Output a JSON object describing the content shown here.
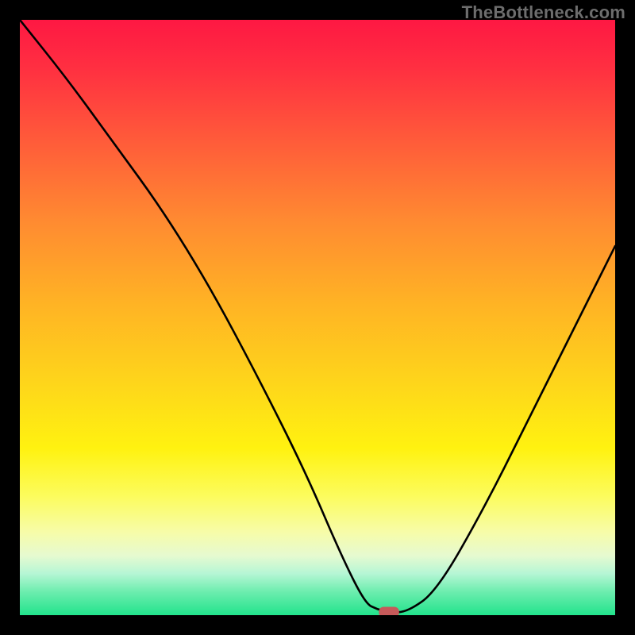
{
  "brand": "TheBottleneck.com",
  "chart_data": {
    "type": "line",
    "title": "",
    "xlabel": "",
    "ylabel": "",
    "xlim": [
      0,
      100
    ],
    "ylim": [
      0,
      100
    ],
    "background_gradient": {
      "direction": "top-to-bottom",
      "stops": [
        {
          "pos": 0,
          "color": "#fe1843"
        },
        {
          "pos": 8,
          "color": "#ff2f41"
        },
        {
          "pos": 20,
          "color": "#ff5a3a"
        },
        {
          "pos": 34,
          "color": "#ff8b31"
        },
        {
          "pos": 48,
          "color": "#ffb424"
        },
        {
          "pos": 62,
          "color": "#fed81a"
        },
        {
          "pos": 72,
          "color": "#fff210"
        },
        {
          "pos": 80,
          "color": "#fcfc5d"
        },
        {
          "pos": 86,
          "color": "#f7fca8"
        },
        {
          "pos": 90,
          "color": "#e6fad0"
        },
        {
          "pos": 93,
          "color": "#b6f6d5"
        },
        {
          "pos": 96,
          "color": "#6eedaf"
        },
        {
          "pos": 100,
          "color": "#22e38c"
        }
      ]
    },
    "series": [
      {
        "name": "curve",
        "x": [
          0,
          8,
          16,
          24,
          32,
          40,
          48,
          54,
          58,
          60,
          62,
          65,
          70,
          78,
          86,
          94,
          100
        ],
        "y": [
          100,
          90,
          79,
          68,
          55,
          40,
          24,
          10,
          2,
          1,
          0.5,
          0.5,
          4,
          18,
          34,
          50,
          62
        ]
      }
    ],
    "marker": {
      "shape": "rounded-rect",
      "x": 62,
      "y": 0.5,
      "width_pct": 3.4,
      "height_pct": 1.8,
      "color": "#c65a5a"
    }
  }
}
